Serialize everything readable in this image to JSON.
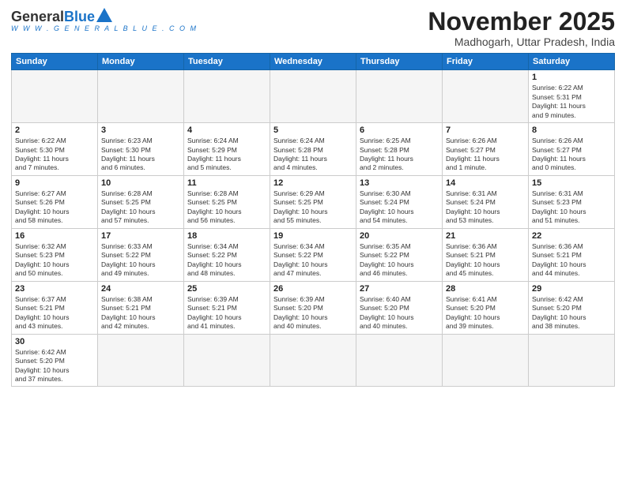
{
  "header": {
    "logo": {
      "general": "General",
      "blue": "Blue",
      "sub": "W W W . G E N E R A L B L U E . C O M"
    },
    "title": "November 2025",
    "subtitle": "Madhogarh, Uttar Pradesh, India"
  },
  "weekdays": [
    "Sunday",
    "Monday",
    "Tuesday",
    "Wednesday",
    "Thursday",
    "Friday",
    "Saturday"
  ],
  "weeks": [
    [
      {
        "day": "",
        "info": ""
      },
      {
        "day": "",
        "info": ""
      },
      {
        "day": "",
        "info": ""
      },
      {
        "day": "",
        "info": ""
      },
      {
        "day": "",
        "info": ""
      },
      {
        "day": "",
        "info": ""
      },
      {
        "day": "1",
        "info": "Sunrise: 6:22 AM\nSunset: 5:31 PM\nDaylight: 11 hours\nand 9 minutes."
      }
    ],
    [
      {
        "day": "2",
        "info": "Sunrise: 6:22 AM\nSunset: 5:30 PM\nDaylight: 11 hours\nand 7 minutes."
      },
      {
        "day": "3",
        "info": "Sunrise: 6:23 AM\nSunset: 5:30 PM\nDaylight: 11 hours\nand 6 minutes."
      },
      {
        "day": "4",
        "info": "Sunrise: 6:24 AM\nSunset: 5:29 PM\nDaylight: 11 hours\nand 5 minutes."
      },
      {
        "day": "5",
        "info": "Sunrise: 6:24 AM\nSunset: 5:28 PM\nDaylight: 11 hours\nand 4 minutes."
      },
      {
        "day": "6",
        "info": "Sunrise: 6:25 AM\nSunset: 5:28 PM\nDaylight: 11 hours\nand 2 minutes."
      },
      {
        "day": "7",
        "info": "Sunrise: 6:26 AM\nSunset: 5:27 PM\nDaylight: 11 hours\nand 1 minute."
      },
      {
        "day": "8",
        "info": "Sunrise: 6:26 AM\nSunset: 5:27 PM\nDaylight: 11 hours\nand 0 minutes."
      }
    ],
    [
      {
        "day": "9",
        "info": "Sunrise: 6:27 AM\nSunset: 5:26 PM\nDaylight: 10 hours\nand 58 minutes."
      },
      {
        "day": "10",
        "info": "Sunrise: 6:28 AM\nSunset: 5:25 PM\nDaylight: 10 hours\nand 57 minutes."
      },
      {
        "day": "11",
        "info": "Sunrise: 6:28 AM\nSunset: 5:25 PM\nDaylight: 10 hours\nand 56 minutes."
      },
      {
        "day": "12",
        "info": "Sunrise: 6:29 AM\nSunset: 5:25 PM\nDaylight: 10 hours\nand 55 minutes."
      },
      {
        "day": "13",
        "info": "Sunrise: 6:30 AM\nSunset: 5:24 PM\nDaylight: 10 hours\nand 54 minutes."
      },
      {
        "day": "14",
        "info": "Sunrise: 6:31 AM\nSunset: 5:24 PM\nDaylight: 10 hours\nand 53 minutes."
      },
      {
        "day": "15",
        "info": "Sunrise: 6:31 AM\nSunset: 5:23 PM\nDaylight: 10 hours\nand 51 minutes."
      }
    ],
    [
      {
        "day": "16",
        "info": "Sunrise: 6:32 AM\nSunset: 5:23 PM\nDaylight: 10 hours\nand 50 minutes."
      },
      {
        "day": "17",
        "info": "Sunrise: 6:33 AM\nSunset: 5:22 PM\nDaylight: 10 hours\nand 49 minutes."
      },
      {
        "day": "18",
        "info": "Sunrise: 6:34 AM\nSunset: 5:22 PM\nDaylight: 10 hours\nand 48 minutes."
      },
      {
        "day": "19",
        "info": "Sunrise: 6:34 AM\nSunset: 5:22 PM\nDaylight: 10 hours\nand 47 minutes."
      },
      {
        "day": "20",
        "info": "Sunrise: 6:35 AM\nSunset: 5:22 PM\nDaylight: 10 hours\nand 46 minutes."
      },
      {
        "day": "21",
        "info": "Sunrise: 6:36 AM\nSunset: 5:21 PM\nDaylight: 10 hours\nand 45 minutes."
      },
      {
        "day": "22",
        "info": "Sunrise: 6:36 AM\nSunset: 5:21 PM\nDaylight: 10 hours\nand 44 minutes."
      }
    ],
    [
      {
        "day": "23",
        "info": "Sunrise: 6:37 AM\nSunset: 5:21 PM\nDaylight: 10 hours\nand 43 minutes."
      },
      {
        "day": "24",
        "info": "Sunrise: 6:38 AM\nSunset: 5:21 PM\nDaylight: 10 hours\nand 42 minutes."
      },
      {
        "day": "25",
        "info": "Sunrise: 6:39 AM\nSunset: 5:21 PM\nDaylight: 10 hours\nand 41 minutes."
      },
      {
        "day": "26",
        "info": "Sunrise: 6:39 AM\nSunset: 5:20 PM\nDaylight: 10 hours\nand 40 minutes."
      },
      {
        "day": "27",
        "info": "Sunrise: 6:40 AM\nSunset: 5:20 PM\nDaylight: 10 hours\nand 40 minutes."
      },
      {
        "day": "28",
        "info": "Sunrise: 6:41 AM\nSunset: 5:20 PM\nDaylight: 10 hours\nand 39 minutes."
      },
      {
        "day": "29",
        "info": "Sunrise: 6:42 AM\nSunset: 5:20 PM\nDaylight: 10 hours\nand 38 minutes."
      }
    ],
    [
      {
        "day": "30",
        "info": "Sunrise: 6:42 AM\nSunset: 5:20 PM\nDaylight: 10 hours\nand 37 minutes."
      },
      {
        "day": "",
        "info": ""
      },
      {
        "day": "",
        "info": ""
      },
      {
        "day": "",
        "info": ""
      },
      {
        "day": "",
        "info": ""
      },
      {
        "day": "",
        "info": ""
      },
      {
        "day": "",
        "info": ""
      }
    ]
  ]
}
